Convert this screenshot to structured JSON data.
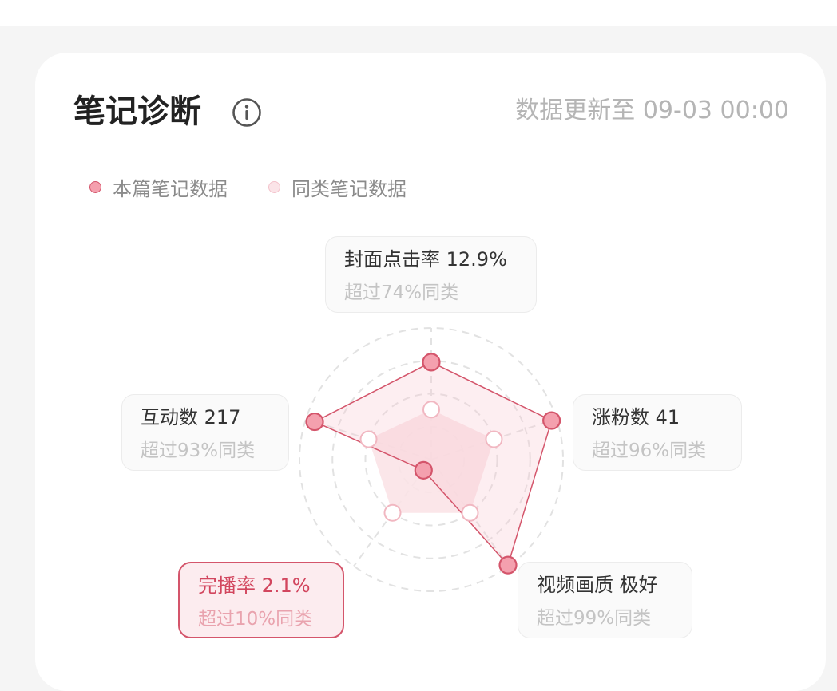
{
  "header": {
    "title": "笔记诊断",
    "updated": "数据更新至 09-03 00:00"
  },
  "legend": [
    {
      "label": "本篇笔记数据",
      "color": "#f4a0ae"
    },
    {
      "label": "同类笔记数据",
      "color": "#fbe4e8"
    }
  ],
  "colors": {
    "accent": "#d4556b",
    "alert_bg": "#fcecef"
  },
  "chart_data": {
    "type": "radar",
    "axes": [
      "封面点击率",
      "涨粉数",
      "视频画质",
      "完播率",
      "互动数"
    ],
    "rmax": 100,
    "rings": 4,
    "series": [
      {
        "name": "本篇笔记数据",
        "values": [
          74,
          96,
          99,
          10,
          93
        ]
      },
      {
        "name": "同类笔记数据",
        "values": [
          38,
          50,
          50,
          50,
          50
        ]
      }
    ]
  },
  "metrics": [
    {
      "label": "封面点击率 12.9%",
      "percentile": "超过74%同类",
      "alert": false
    },
    {
      "label": "涨粉数 41",
      "percentile": "超过96%同类",
      "alert": false
    },
    {
      "label": "视频画质 极好",
      "percentile": "超过99%同类",
      "alert": false
    },
    {
      "label": "完播率 2.1%",
      "percentile": "超过10%同类",
      "alert": true
    },
    {
      "label": "互动数 217",
      "percentile": "超过93%同类",
      "alert": false
    }
  ]
}
